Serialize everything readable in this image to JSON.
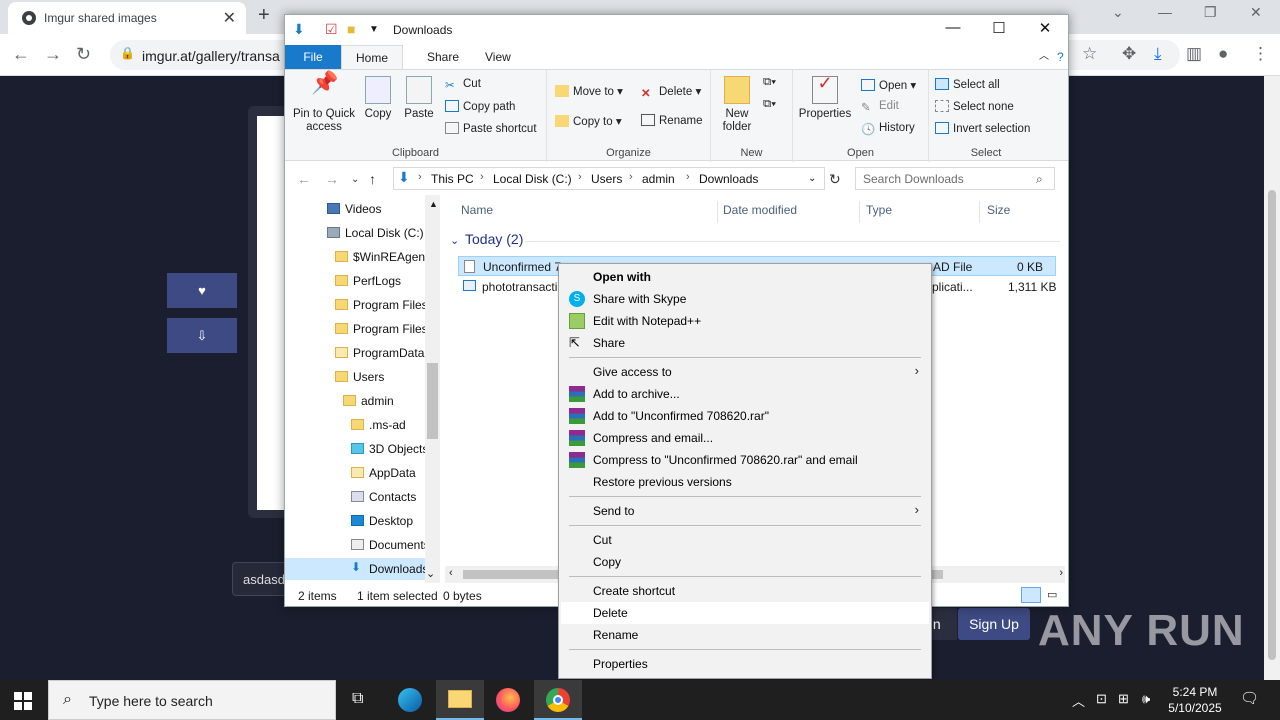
{
  "browser": {
    "tab_title": "Imgur shared images",
    "url": "imgur.at/gallery/transa",
    "new_tab": "+"
  },
  "imgur": {
    "btn_heart": "♥",
    "btn_down": "⇩",
    "comment_text": "asdasd",
    "signin_label": "In",
    "signup_label": "Sign Up"
  },
  "watermark": "ANY RUN",
  "explorer": {
    "title": "Downloads",
    "tabs": [
      "File",
      "Home",
      "Share",
      "View"
    ],
    "ribbon": {
      "clipboard": {
        "label": "Clipboard",
        "pin": "Pin to Quick access",
        "copy": "Copy",
        "paste": "Paste",
        "cut": "Cut",
        "copy_path": "Copy path",
        "paste_shortcut": "Paste shortcut"
      },
      "organize": {
        "label": "Organize",
        "move_to": "Move to",
        "copy_to": "Copy to",
        "delete": "Delete",
        "rename": "Rename"
      },
      "new": {
        "label": "New",
        "new_folder": "New folder"
      },
      "open": {
        "label": "Open",
        "properties": "Properties",
        "open": "Open",
        "edit": "Edit",
        "history": "History"
      },
      "select": {
        "label": "Select",
        "select_all": "Select all",
        "select_none": "Select none",
        "invert": "Invert selection"
      }
    },
    "breadcrumb": [
      "This PC",
      "Local Disk (C:)",
      "Users",
      "admin",
      "Downloads"
    ],
    "search_placeholder": "Search Downloads",
    "nav_items": [
      "Videos",
      "Local Disk (C:)",
      "$WinREAgent",
      "PerfLogs",
      "Program Files",
      "Program Files",
      "ProgramData",
      "Users",
      "admin",
      ".ms-ad",
      "3D Objects",
      "AppData",
      "Contacts",
      "Desktop",
      "Documents",
      "Downloads"
    ],
    "columns": [
      "Name",
      "Date modified",
      "Type",
      "Size"
    ],
    "group_header": "Today (2)",
    "files": [
      {
        "name": "Unconfirmed 7",
        "type": "AD File",
        "size": "0 KB"
      },
      {
        "name": "phototransacti",
        "type": "plicati...",
        "size": "1,311 KB"
      }
    ],
    "status": {
      "items": "2 items",
      "selected": "1 item selected",
      "bytes": "0 bytes"
    }
  },
  "context_menu": {
    "items": [
      "Open with",
      "Share with Skype",
      "Edit with Notepad++",
      "Share",
      "Give access to",
      "Add to archive...",
      "Add to \"Unconfirmed 708620.rar\"",
      "Compress and email...",
      "Compress to \"Unconfirmed 708620.rar\" and email",
      "Restore previous versions",
      "Send to",
      "Cut",
      "Copy",
      "Create shortcut",
      "Delete",
      "Rename",
      "Properties"
    ]
  },
  "taskbar": {
    "search_placeholder": "Type here to search",
    "time": "5:24 PM",
    "date": "5/10/2025"
  },
  "colors": {
    "file_tab": "#1979ca",
    "selection": "#cce8ff",
    "imgur_button": "#3e4a83",
    "page_bg": "#1b1e2e"
  }
}
